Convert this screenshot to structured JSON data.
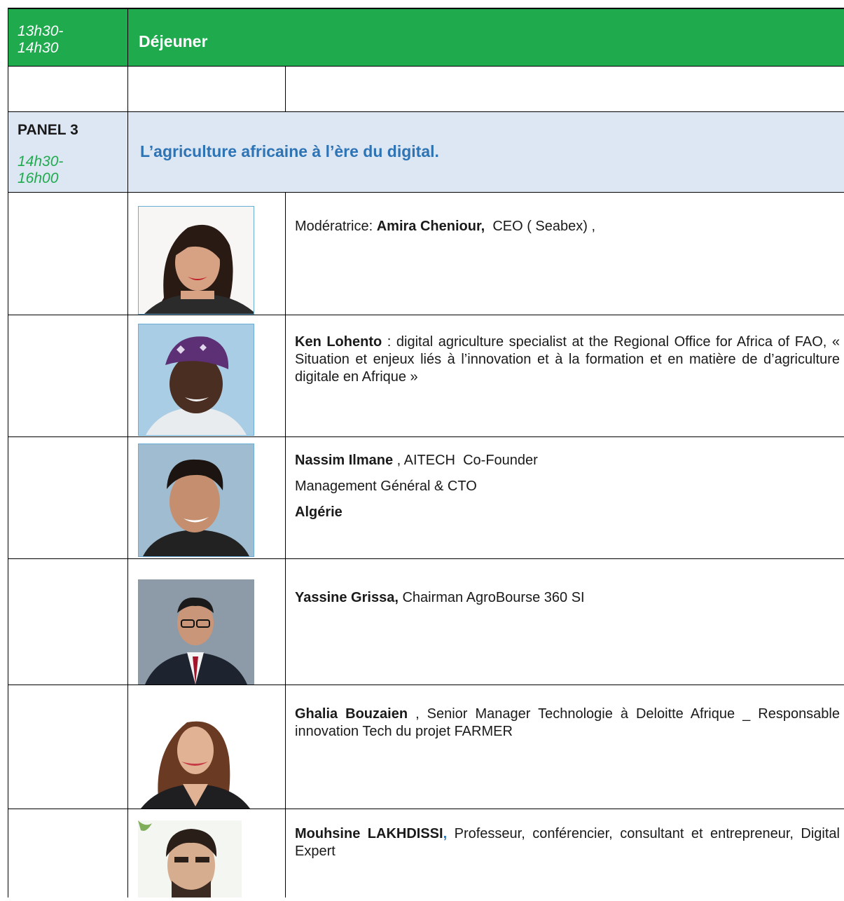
{
  "lunch": {
    "time": "13h30-\n14h30",
    "title": "Déjeuner"
  },
  "panel": {
    "label": "PANEL 3",
    "time": "14h30-\n16h00",
    "title": "L’agriculture africaine à l’ère du digital."
  },
  "speakers": [
    {
      "name": "Amira Cheniour,",
      "prefix": "Modératrice: ",
      "text": "  CEO ( Seabex) ,",
      "photo": "woman-dark-hair-portrait"
    },
    {
      "name": "Ken Lohento",
      "text": " : digital agriculture specialist at the Regional Office for Africa of FAO, « Situation et enjeux liés à l’innovation et à la formation et en matière de d’agriculture digitale en Afrique »",
      "photo": "man-purple-cap-portrait"
    },
    {
      "name": "Nassim Ilmane",
      "text": " , AITECH  Co-Founder",
      "line2": "Management Général & CTO",
      "line3": "Algérie",
      "photo": "man-curly-hair-portrait"
    },
    {
      "name": "Yassine Grissa,",
      "text": " Chairman AgroBourse 360 SI",
      "photo": "man-suit-glasses-portrait"
    },
    {
      "name": "Ghalia Bouzaien",
      "text": " , Senior Manager Technologie à Deloitte Afrique _ Responsable innovation Tech du projet FARMER",
      "photo": "woman-long-hair-portrait"
    },
    {
      "name": "Mouhsine LAKHDISSI",
      "comma": ",",
      "text": " Professeur, conférencier, consultant et entrepreneur, Digital Expert",
      "photo": "man-beard-portrait"
    }
  ],
  "colors": {
    "green": "#1faa4e",
    "panel_bg": "#dde7f3",
    "blue": "#2e74b5"
  }
}
